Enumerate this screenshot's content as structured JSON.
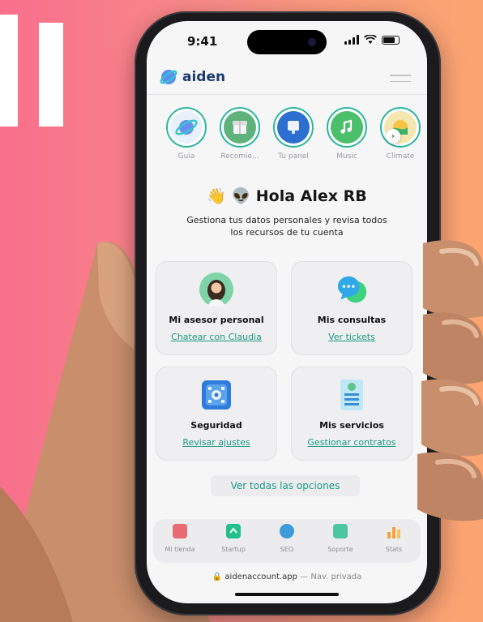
{
  "status": {
    "time": "9:41"
  },
  "brand": {
    "name": "aiden"
  },
  "stories": [
    {
      "label": "Guía",
      "icon": "planet-icon"
    },
    {
      "label": "Recomie...",
      "icon": "gift-box-icon"
    },
    {
      "label": "Tu panel",
      "icon": "monitor-icon"
    },
    {
      "label": "Music",
      "icon": "music-note-icon"
    },
    {
      "label": "Climate",
      "icon": "climate-icon"
    }
  ],
  "greeting": {
    "emojis": "👋 👽",
    "text": "Hola Alex RB"
  },
  "subtitle": "Gestiona tus datos personales y revisa todos los recursos de tu cuenta",
  "cards": [
    {
      "title": "Mi asesor personal",
      "link": "Chatear con Claudia"
    },
    {
      "title": "Mis consultas",
      "link": "Ver tickets"
    },
    {
      "title": "Seguridad",
      "link": "Revisar ajustes"
    },
    {
      "title": "Mis servicios",
      "link": "Gestionar contratos"
    }
  ],
  "all_options": "Ver todas las opciones",
  "tabs": [
    {
      "label": "Mi tienda",
      "color": "#e86a72"
    },
    {
      "label": "Startup",
      "color": "#22c08b"
    },
    {
      "label": "SEO",
      "color": "#3c9bd9"
    },
    {
      "label": "Soporte",
      "color": "#4cc6a0"
    },
    {
      "label": "Stats",
      "color": "#f3a13a"
    }
  ],
  "url": {
    "domain": "aidenaccount.app",
    "mode": "— Nav. privada"
  },
  "colors": {
    "accent": "#1a9a84",
    "brand": "#1c3b6e",
    "background_left": "#f86f8c",
    "background_right": "#fca571"
  }
}
